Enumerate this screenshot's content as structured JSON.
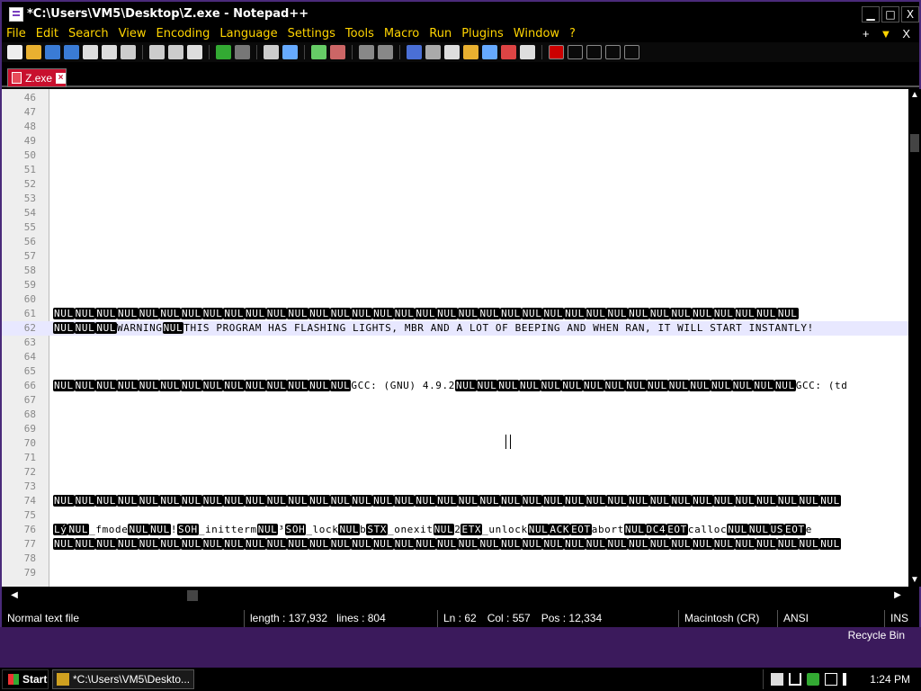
{
  "window": {
    "title": "*C:\\Users\\VM5\\Desktop\\Z.exe - Notepad++"
  },
  "menu": [
    "File",
    "Edit",
    "Search",
    "View",
    "Encoding",
    "Language",
    "Settings",
    "Tools",
    "Macro",
    "Run",
    "Plugins",
    "Window",
    "?"
  ],
  "menu_extra": {
    "plus": "+",
    "dropdown": "▼",
    "close": "X"
  },
  "tab": {
    "name": "Z.exe",
    "close": "×"
  },
  "lines": [
    {
      "n": "46",
      "segs": []
    },
    {
      "n": "47",
      "segs": []
    },
    {
      "n": "48",
      "segs": []
    },
    {
      "n": "49",
      "segs": []
    },
    {
      "n": "50",
      "segs": []
    },
    {
      "n": "51",
      "segs": []
    },
    {
      "n": "52",
      "segs": []
    },
    {
      "n": "53",
      "segs": []
    },
    {
      "n": "54",
      "segs": []
    },
    {
      "n": "55",
      "segs": []
    },
    {
      "n": "56",
      "segs": []
    },
    {
      "n": "57",
      "segs": []
    },
    {
      "n": "58",
      "segs": []
    },
    {
      "n": "59",
      "segs": []
    },
    {
      "n": "60",
      "segs": []
    },
    {
      "n": "61",
      "segs": [
        {
          "t": "NUL",
          "k": 1
        },
        {
          "t": "NUL",
          "k": 1
        },
        {
          "t": "NUL",
          "k": 1
        },
        {
          "t": "NUL",
          "k": 1
        },
        {
          "t": "NUL",
          "k": 1
        },
        {
          "t": "NUL",
          "k": 1
        },
        {
          "t": "NUL",
          "k": 1
        },
        {
          "t": "NUL",
          "k": 1
        },
        {
          "t": "NUL",
          "k": 1
        },
        {
          "t": "NUL",
          "k": 1
        },
        {
          "t": "NUL",
          "k": 1
        },
        {
          "t": "NUL",
          "k": 1
        },
        {
          "t": "NUL",
          "k": 1
        },
        {
          "t": "NUL",
          "k": 1
        },
        {
          "t": "NUL",
          "k": 1
        },
        {
          "t": "NUL",
          "k": 1
        },
        {
          "t": "NUL",
          "k": 1
        },
        {
          "t": "NUL",
          "k": 1
        },
        {
          "t": "NUL",
          "k": 1
        },
        {
          "t": "NUL",
          "k": 1
        },
        {
          "t": "NUL",
          "k": 1
        },
        {
          "t": "NUL",
          "k": 1
        },
        {
          "t": "NUL",
          "k": 1
        },
        {
          "t": "NUL",
          "k": 1
        },
        {
          "t": "NUL",
          "k": 1
        },
        {
          "t": "NUL",
          "k": 1
        },
        {
          "t": "NUL",
          "k": 1
        },
        {
          "t": "NUL",
          "k": 1
        },
        {
          "t": "NUL",
          "k": 1
        },
        {
          "t": "NUL",
          "k": 1
        },
        {
          "t": "NUL",
          "k": 1
        },
        {
          "t": "NUL",
          "k": 1
        },
        {
          "t": "NUL",
          "k": 1
        },
        {
          "t": "NUL",
          "k": 1
        },
        {
          "t": "NUL",
          "k": 1
        }
      ]
    },
    {
      "n": "62",
      "cur": true,
      "segs": [
        {
          "t": "NUL",
          "k": 1
        },
        {
          "t": "NUL",
          "k": 1
        },
        {
          "t": "NUL",
          "k": 1
        },
        {
          "t": "WARNING",
          "k": 0
        },
        {
          "t": "NUL",
          "k": 1
        },
        {
          "t": "THIS PROGRAM HAS FLASHING LIGHTS, MBR AND A LOT OF BEEPING AND WHEN RAN, IT WILL START INSTANTLY! ",
          "k": 0
        }
      ]
    },
    {
      "n": "63",
      "segs": []
    },
    {
      "n": "64",
      "segs": []
    },
    {
      "n": "65",
      "segs": []
    },
    {
      "n": "66",
      "segs": [
        {
          "t": "NUL",
          "k": 1
        },
        {
          "t": "NUL",
          "k": 1
        },
        {
          "t": "NUL",
          "k": 1
        },
        {
          "t": "NUL",
          "k": 1
        },
        {
          "t": "NUL",
          "k": 1
        },
        {
          "t": "NUL",
          "k": 1
        },
        {
          "t": "NUL",
          "k": 1
        },
        {
          "t": "NUL",
          "k": 1
        },
        {
          "t": "NUL",
          "k": 1
        },
        {
          "t": "NUL",
          "k": 1
        },
        {
          "t": "NUL",
          "k": 1
        },
        {
          "t": "NUL",
          "k": 1
        },
        {
          "t": "NUL",
          "k": 1
        },
        {
          "t": "NUL",
          "k": 1
        },
        {
          "t": "GCC: (GNU) 4.9.2",
          "k": 0
        },
        {
          "t": "NUL",
          "k": 1
        },
        {
          "t": "NUL",
          "k": 1
        },
        {
          "t": "NUL",
          "k": 1
        },
        {
          "t": "NUL",
          "k": 1
        },
        {
          "t": "NUL",
          "k": 1
        },
        {
          "t": "NUL",
          "k": 1
        },
        {
          "t": "NUL",
          "k": 1
        },
        {
          "t": "NUL",
          "k": 1
        },
        {
          "t": "NUL",
          "k": 1
        },
        {
          "t": "NUL",
          "k": 1
        },
        {
          "t": "NUL",
          "k": 1
        },
        {
          "t": "NUL",
          "k": 1
        },
        {
          "t": "NUL",
          "k": 1
        },
        {
          "t": "NUL",
          "k": 1
        },
        {
          "t": "NUL",
          "k": 1
        },
        {
          "t": "NUL",
          "k": 1
        },
        {
          "t": "GCC: (td",
          "k": 0
        }
      ]
    },
    {
      "n": "67",
      "segs": []
    },
    {
      "n": "68",
      "segs": []
    },
    {
      "n": "69",
      "segs": []
    },
    {
      "n": "70",
      "segs": []
    },
    {
      "n": "71",
      "segs": []
    },
    {
      "n": "72",
      "segs": []
    },
    {
      "n": "73",
      "segs": []
    },
    {
      "n": "74",
      "segs": [
        {
          "t": "NUL",
          "k": 1
        },
        {
          "t": "NUL",
          "k": 1
        },
        {
          "t": "NUL",
          "k": 1
        },
        {
          "t": "NUL",
          "k": 1
        },
        {
          "t": "NUL",
          "k": 1
        },
        {
          "t": "NUL",
          "k": 1
        },
        {
          "t": "NUL",
          "k": 1
        },
        {
          "t": "NUL",
          "k": 1
        },
        {
          "t": "NUL",
          "k": 1
        },
        {
          "t": "NUL",
          "k": 1
        },
        {
          "t": "NUL",
          "k": 1
        },
        {
          "t": "NUL",
          "k": 1
        },
        {
          "t": "NUL",
          "k": 1
        },
        {
          "t": "NUL",
          "k": 1
        },
        {
          "t": "NUL",
          "k": 1
        },
        {
          "t": "NUL",
          "k": 1
        },
        {
          "t": "NUL",
          "k": 1
        },
        {
          "t": "NUL",
          "k": 1
        },
        {
          "t": "NUL",
          "k": 1
        },
        {
          "t": "NUL",
          "k": 1
        },
        {
          "t": "NUL",
          "k": 1
        },
        {
          "t": "NUL",
          "k": 1
        },
        {
          "t": "NUL",
          "k": 1
        },
        {
          "t": "NUL",
          "k": 1
        },
        {
          "t": "NUL",
          "k": 1
        },
        {
          "t": "NUL",
          "k": 1
        },
        {
          "t": "NUL",
          "k": 1
        },
        {
          "t": "NUL",
          "k": 1
        },
        {
          "t": "NUL",
          "k": 1
        },
        {
          "t": "NUL",
          "k": 1
        },
        {
          "t": "NUL",
          "k": 1
        },
        {
          "t": "NUL",
          "k": 1
        },
        {
          "t": "NUL",
          "k": 1
        },
        {
          "t": "NUL",
          "k": 1
        },
        {
          "t": "NUL",
          "k": 1
        },
        {
          "t": "NUL",
          "k": 1
        },
        {
          "t": "NUL",
          "k": 1
        }
      ]
    },
    {
      "n": "75",
      "segs": []
    },
    {
      "n": "76",
      "segs": [
        {
          "t": "Lý",
          "k": 1
        },
        {
          "t": "NUL",
          "k": 1
        },
        {
          "t": "_fmode",
          "k": 0
        },
        {
          "t": "NUL",
          "k": 1
        },
        {
          "t": "NUL",
          "k": 1
        },
        {
          "t": "!",
          "k": 0
        },
        {
          "t": "SOH",
          "k": 1
        },
        {
          "t": "_initterm",
          "k": 0
        },
        {
          "t": "NUL",
          "k": 1
        },
        {
          "t": "³",
          "k": 0
        },
        {
          "t": "SOH",
          "k": 1
        },
        {
          "t": "_lock",
          "k": 0
        },
        {
          "t": "NUL",
          "k": 1
        },
        {
          "t": "b",
          "k": 0
        },
        {
          "t": "STX",
          "k": 1
        },
        {
          "t": "_onexit",
          "k": 0
        },
        {
          "t": "NUL",
          "k": 1
        },
        {
          "t": "2",
          "k": 0
        },
        {
          "t": "ETX",
          "k": 1
        },
        {
          "t": "_unlock",
          "k": 0
        },
        {
          "t": "NUL",
          "k": 1
        },
        {
          "t": "ACK",
          "k": 1
        },
        {
          "t": "EOT",
          "k": 1
        },
        {
          "t": "abort",
          "k": 0
        },
        {
          "t": "NUL",
          "k": 1
        },
        {
          "t": "DC4",
          "k": 1
        },
        {
          "t": "EOT",
          "k": 1
        },
        {
          "t": "calloc",
          "k": 0
        },
        {
          "t": "NUL",
          "k": 1
        },
        {
          "t": "NUL",
          "k": 1
        },
        {
          "t": "US",
          "k": 1
        },
        {
          "t": "EOT",
          "k": 1
        },
        {
          "t": "e",
          "k": 0
        }
      ]
    },
    {
      "n": "77",
      "segs": [
        {
          "t": "NUL",
          "k": 1
        },
        {
          "t": "NUL",
          "k": 1
        },
        {
          "t": "NUL",
          "k": 1
        },
        {
          "t": "NUL",
          "k": 1
        },
        {
          "t": "NUL",
          "k": 1
        },
        {
          "t": "NUL",
          "k": 1
        },
        {
          "t": "NUL",
          "k": 1
        },
        {
          "t": "NUL",
          "k": 1
        },
        {
          "t": "NUL",
          "k": 1
        },
        {
          "t": "NUL",
          "k": 1
        },
        {
          "t": "NUL",
          "k": 1
        },
        {
          "t": "NUL",
          "k": 1
        },
        {
          "t": "NUL",
          "k": 1
        },
        {
          "t": "NUL",
          "k": 1
        },
        {
          "t": "NUL",
          "k": 1
        },
        {
          "t": "NUL",
          "k": 1
        },
        {
          "t": "NUL",
          "k": 1
        },
        {
          "t": "NUL",
          "k": 1
        },
        {
          "t": "NUL",
          "k": 1
        },
        {
          "t": "NUL",
          "k": 1
        },
        {
          "t": "NUL",
          "k": 1
        },
        {
          "t": "NUL",
          "k": 1
        },
        {
          "t": "NUL",
          "k": 1
        },
        {
          "t": "NUL",
          "k": 1
        },
        {
          "t": "NUL",
          "k": 1
        },
        {
          "t": "NUL",
          "k": 1
        },
        {
          "t": "NUL",
          "k": 1
        },
        {
          "t": "NUL",
          "k": 1
        },
        {
          "t": "NUL",
          "k": 1
        },
        {
          "t": "NUL",
          "k": 1
        },
        {
          "t": "NUL",
          "k": 1
        },
        {
          "t": "NUL",
          "k": 1
        },
        {
          "t": "NUL",
          "k": 1
        },
        {
          "t": "NUL",
          "k": 1
        },
        {
          "t": "NUL",
          "k": 1
        },
        {
          "t": "NUL",
          "k": 1
        },
        {
          "t": "NUL",
          "k": 1
        }
      ]
    },
    {
      "n": "78",
      "segs": []
    },
    {
      "n": "79",
      "segs": []
    }
  ],
  "status": {
    "type": "Normal text file",
    "length": "length : 137,932",
    "lines": "lines : 804",
    "ln": "Ln : 62",
    "col": "Col : 557",
    "pos": "Pos : 12,334",
    "eol": "Macintosh (CR)",
    "encoding": "ANSI",
    "mode": "INS"
  },
  "desktop": {
    "recycle_bin": "Recycle Bin"
  },
  "taskbar": {
    "start": "Start",
    "task": "*C:\\Users\\VM5\\Deskto...",
    "clock": "1:24 PM"
  },
  "colors": {
    "accent": "#ffd400",
    "tab": "#c8102e",
    "desktop": "#3b1a5c"
  },
  "toolbar_icons": [
    "new-icon",
    "open-icon",
    "save-icon",
    "save-all-icon",
    "close-icon",
    "close-all-icon",
    "print-icon",
    "cut-icon",
    "copy-icon",
    "paste-icon",
    "undo-icon",
    "redo-icon",
    "find-icon",
    "replace-icon",
    "zoom-in-icon",
    "zoom-out-icon",
    "sync-v-icon",
    "sync-h-icon",
    "wrap-icon",
    "show-all-icon",
    "indent-guide-icon",
    "doc-map-icon",
    "func-list-icon",
    "folder-ws-icon",
    "monitor-icon",
    "record-icon",
    "stop-icon",
    "play-icon",
    "play-multi-icon",
    "save-macro-icon"
  ]
}
